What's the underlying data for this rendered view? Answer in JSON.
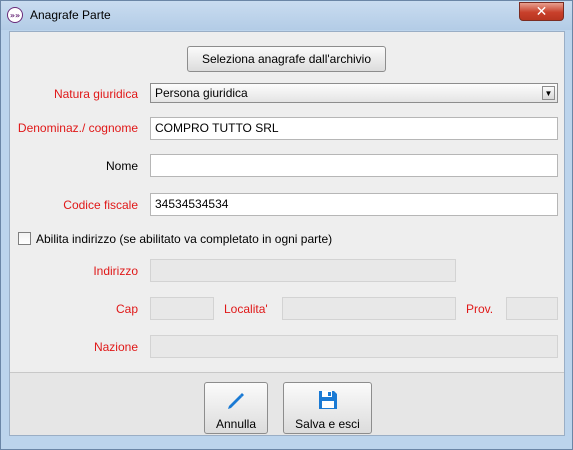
{
  "window": {
    "title": "Anagrafe Parte",
    "app_icon": "»»",
    "close_glyph": "✕"
  },
  "form": {
    "select_archive_button": "Seleziona anagrafe dall'archivio",
    "natura": {
      "label": "Natura giuridica",
      "value": "Persona giuridica",
      "arrow": "▼"
    },
    "denominazione": {
      "label": "Denominaz./ cognome",
      "value": "COMPRO TUTTO SRL"
    },
    "nome": {
      "label": "Nome",
      "value": ""
    },
    "codice_fiscale": {
      "label": "Codice fiscale",
      "value": "34534534534"
    },
    "abilita_indirizzo": {
      "label": "Abilita indirizzo (se abilitato va completato in ogni parte)",
      "checked": false
    },
    "indirizzo": {
      "label": "Indirizzo",
      "value": ""
    },
    "cap": {
      "label": "Cap",
      "value": ""
    },
    "localita": {
      "label": "Localita'",
      "value": ""
    },
    "prov": {
      "label": "Prov.",
      "value": ""
    },
    "nazione": {
      "label": "Nazione",
      "value": ""
    }
  },
  "footer": {
    "annulla": {
      "label": "Annulla",
      "icon": "pencil-icon"
    },
    "salva": {
      "label": "Salva e esci",
      "icon": "floppy-disk-icon"
    }
  },
  "colors": {
    "required_label": "#e01818",
    "icon_blue": "#1a7ad4",
    "titlebar": "#b9d1ea",
    "close_red": "#c8402b"
  }
}
